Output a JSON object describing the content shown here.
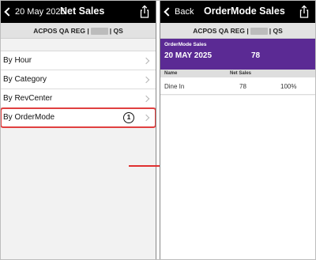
{
  "left": {
    "back_label": "20 May 2025",
    "title": "Net Sales",
    "subheader": {
      "prefix": "ACPOS QA REG |",
      "suffix": "| QS"
    },
    "items": [
      {
        "label": "By Hour"
      },
      {
        "label": "By Category"
      },
      {
        "label": "By RevCenter"
      },
      {
        "label": "By OrderMode",
        "badge": "1"
      }
    ]
  },
  "right": {
    "back_label": "Back",
    "title": "OrderMode Sales",
    "subheader": {
      "prefix": "ACPOS QA REG |",
      "suffix": "| QS"
    },
    "summary": {
      "label": "OrderMode Sales",
      "date": "20 MAY 2025",
      "value": "78"
    },
    "table": {
      "headers": [
        "Name",
        "Net Sales"
      ],
      "rows": [
        {
          "name": "Dine In",
          "net_sales": "78",
          "percent": "100%"
        }
      ]
    }
  },
  "colors": {
    "accent": "#5b2a94",
    "nav": "#000000",
    "highlight": "#e04040",
    "arrow": "#e03030"
  },
  "icons": [
    "chevron-left-icon",
    "share-icon",
    "chevron-right-icon",
    "arrow-right-icon"
  ]
}
